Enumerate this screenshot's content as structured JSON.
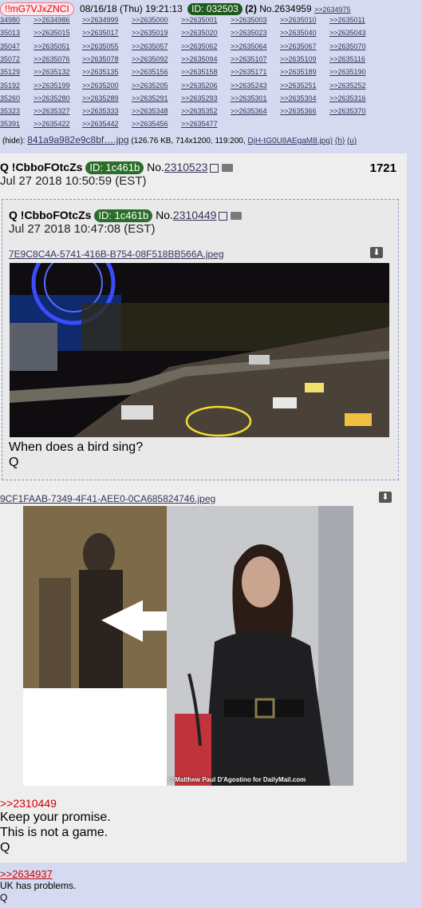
{
  "header": {
    "tripcode": "!!mG7VJxZNCI",
    "datetime": "08/16/18 (Thu) 19:21:13",
    "id_label": "ID: 032503",
    "reply_count": "(2)",
    "post_no": "No.2634959",
    "first_backlink": ">>2634975",
    "backlink_rows": [
      [
        "34980",
        ">>2634986",
        ">>2634999",
        ">>2635000",
        ">>2635001",
        ">>2635003",
        ">>2635010",
        ">>2635011"
      ],
      [
        "35013",
        ">>2635015",
        ">>2635017",
        ">>2635019",
        ">>2635020",
        ">>2635023",
        ">>2635040",
        ">>2635043"
      ],
      [
        "35047",
        ">>2635051",
        ">>2635055",
        ">>2635057",
        ">>2635062",
        ">>2635064",
        ">>2635067",
        ">>2635070"
      ],
      [
        "35072",
        ">>2635076",
        ">>2635078",
        ">>2635092",
        ">>2635094",
        ">>2635107",
        ">>2635109",
        ">>2635116"
      ],
      [
        "35129",
        ">>2635132",
        ">>2635135",
        ">>2635156",
        ">>2635158",
        ">>2635171",
        ">>2635189",
        ">>2635190"
      ],
      [
        "35192",
        ">>2635199",
        ">>2635200",
        ">>2635205",
        ">>2635206",
        ">>2635243",
        ">>2635251",
        ">>2635252"
      ],
      [
        "35260",
        ">>2635280",
        ">>2635289",
        ">>2635291",
        ">>2635293",
        ">>2635301",
        ">>2635304",
        ">>2635316"
      ],
      [
        "35323",
        ">>2635327",
        ">>2635333",
        ">>2635348",
        ">>2635352",
        ">>2635364",
        ">>2635366",
        ">>2635370"
      ],
      [
        "35391",
        ">>2635422",
        ">>2635442",
        ">>2635456",
        ">>2635477"
      ]
    ],
    "file": {
      "hide": "(hide):",
      "name": "841a9a982e9c8bf….jpg",
      "meta": "(126.76 KB, 714x1200, 119:200,",
      "orig": "DjH-tG0U8AEgaM8.jpg)",
      "h": "(h)",
      "u": "(u)"
    }
  },
  "post2": {
    "name": "Q !CbboFOtcZs",
    "id_label": "ID: 1c461b",
    "post_no_prefix": "No.",
    "post_no": "2310523",
    "number": "1721",
    "date": "Jul 27 2018 10:50:59 (EST)",
    "quote": {
      "name": "Q !CbboFOtcZs",
      "id_label": "ID: 1c461b",
      "post_no_prefix": "No.",
      "post_no": "2310449",
      "date": "Jul 27 2018 10:47:08 (EST)",
      "filename": "7E9C8C4A-5741-416B-B754-08F518BB566A.jpeg",
      "text_line1": "When does a bird sing?",
      "text_line2": "Q"
    },
    "filename": "9CF1FAAB-7349-4F41-AEE0-0CA685824746.jpeg",
    "photo_credit": "© Matthew Paul D'Agostino for DailyMail.com",
    "reply_link": ">>2310449",
    "lines": [
      "Keep your promise.",
      "This is not a game.",
      "Q"
    ]
  },
  "post3": {
    "reply_link": ">>2634937",
    "lines": [
      "UK has problems.",
      "Q"
    ]
  },
  "colors": {
    "background": "#d6daf0",
    "post_bg": "#eeeeee",
    "link": "#34345c",
    "id_badge": "#1e5a1e",
    "reply_link": "#cc0000"
  }
}
